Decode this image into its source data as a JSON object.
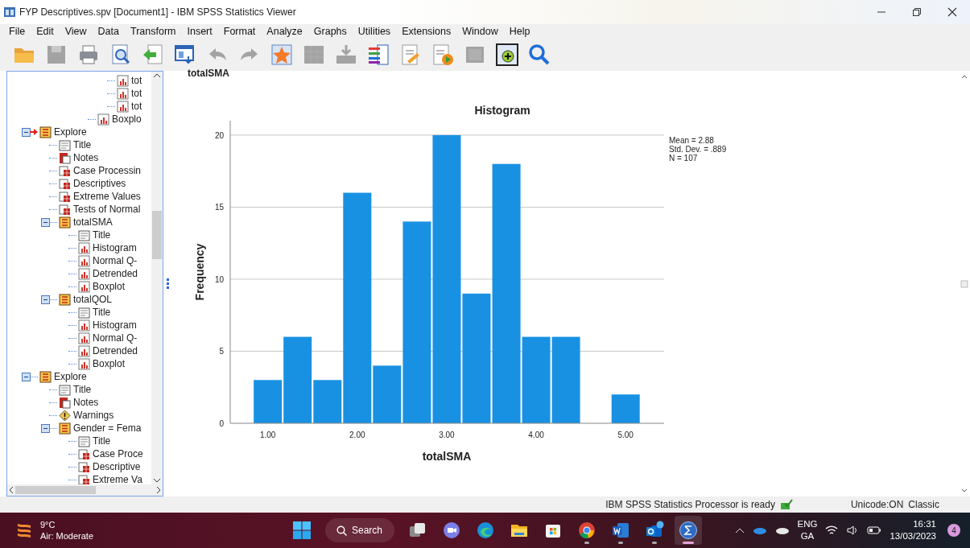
{
  "window": {
    "title": "FYP Descriptives.spv [Document1] - IBM SPSS Statistics Viewer"
  },
  "menu": [
    "File",
    "Edit",
    "View",
    "Data",
    "Transform",
    "Insert",
    "Format",
    "Analyze",
    "Graphs",
    "Utilities",
    "Extensions",
    "Window",
    "Help"
  ],
  "toolbar": [
    {
      "kind": "open",
      "disabled": false
    },
    {
      "kind": "save",
      "disabled": true
    },
    {
      "kind": "print",
      "disabled": false
    },
    {
      "kind": "preview",
      "disabled": false
    },
    {
      "kind": "export",
      "disabled": false
    },
    {
      "kind": "goto",
      "disabled": false
    },
    {
      "kind": "undo",
      "disabled": true
    },
    {
      "kind": "redo",
      "disabled": true
    },
    {
      "kind": "star",
      "disabled": false
    },
    {
      "kind": "grid",
      "disabled": true
    },
    {
      "kind": "insert",
      "disabled": true
    },
    {
      "kind": "variables",
      "disabled": false
    },
    {
      "kind": "note",
      "disabled": false
    },
    {
      "kind": "script",
      "disabled": false
    },
    {
      "kind": "square",
      "disabled": true
    },
    {
      "kind": "add",
      "disabled": false
    },
    {
      "kind": "search",
      "disabled": false
    }
  ],
  "tree": {
    "items": [
      {
        "children": [
          {
            "children": [
              {
                "children": [
                  {
                    "children": [
                      {
                        "label": "tot",
                        "kind": "chart"
                      },
                      {
                        "label": "tot",
                        "kind": "chart"
                      },
                      {
                        "label": "tot",
                        "kind": "chart"
                      }
                    ]
                  },
                  {
                    "label": "Boxplo",
                    "kind": "chart"
                  }
                ]
              }
            ]
          }
        ]
      },
      {
        "label": "Explore",
        "kind": "folder",
        "expanded": true,
        "current": true,
        "children": [
          {
            "label": "Title",
            "kind": "title"
          },
          {
            "label": "Notes",
            "kind": "notes"
          },
          {
            "label": "Case Processin",
            "kind": "table"
          },
          {
            "label": "Descriptives",
            "kind": "table"
          },
          {
            "label": "Extreme Values",
            "kind": "table"
          },
          {
            "label": "Tests of Normal",
            "kind": "table"
          },
          {
            "label": "totalSMA",
            "kind": "folder",
            "expanded": true,
            "current": false,
            "children": [
              {
                "label": "Title",
                "kind": "title"
              },
              {
                "label": "Histogram",
                "kind": "chart"
              },
              {
                "label": "Normal Q-",
                "kind": "chart"
              },
              {
                "label": "Detrended",
                "kind": "chart"
              },
              {
                "label": "Boxplot",
                "kind": "chart"
              }
            ]
          },
          {
            "label": "totalQOL",
            "kind": "folder",
            "expanded": true,
            "current": false,
            "children": [
              {
                "label": "Title",
                "kind": "title"
              },
              {
                "label": "Histogram",
                "kind": "chart"
              },
              {
                "label": "Normal Q-",
                "kind": "chart"
              },
              {
                "label": "Detrended",
                "kind": "chart"
              },
              {
                "label": "Boxplot",
                "kind": "chart"
              }
            ]
          }
        ]
      },
      {
        "label": "Explore",
        "kind": "folder",
        "expanded": true,
        "current": false,
        "children": [
          {
            "label": "Title",
            "kind": "title"
          },
          {
            "label": "Notes",
            "kind": "notes"
          },
          {
            "label": "Warnings",
            "kind": "warning"
          },
          {
            "label": "Gender  = Fema",
            "kind": "folder",
            "expanded": true,
            "current": false,
            "children": [
              {
                "label": "Title",
                "kind": "title"
              },
              {
                "label": "Case Proce",
                "kind": "table"
              },
              {
                "label": "Descriptive",
                "kind": "table"
              },
              {
                "label": "Extreme Va",
                "kind": "table"
              }
            ]
          }
        ]
      }
    ]
  },
  "output": {
    "heading": "totalSMA",
    "chart_data": {
      "type": "bar",
      "title": "Histogram",
      "xlabel": "totalSMA",
      "ylabel": "Frequency",
      "x": [
        1.0,
        1.333,
        1.667,
        2.0,
        2.333,
        2.667,
        3.0,
        3.333,
        3.667,
        4.0,
        4.333,
        4.667,
        5.0
      ],
      "values": [
        3,
        6,
        3,
        16,
        4,
        14,
        20,
        9,
        18,
        6,
        6,
        0,
        2
      ],
      "xlim": [
        0.58,
        5.43
      ],
      "ylim": [
        0,
        21
      ],
      "xticks": [
        {
          "value": 1,
          "label": "1.00"
        },
        {
          "value": 2,
          "label": "2.00"
        },
        {
          "value": 3,
          "label": "3.00"
        },
        {
          "value": 4,
          "label": "4.00"
        },
        {
          "value": 5,
          "label": "5.00"
        }
      ],
      "yticks": [
        0,
        5,
        10,
        15,
        20
      ],
      "grid": true,
      "annotations": [
        "Mean = 2.88",
        "Std. Dev. = .889",
        "N = 107"
      ]
    }
  },
  "status_bar": {
    "message": "IBM SPSS Statistics Processor is ready",
    "unicode": "Unicode:ON",
    "mode": "Classic"
  },
  "taskbar": {
    "weather": {
      "temp": "9°C",
      "text": "Air: Moderate"
    },
    "search": "Search",
    "apps": [
      {
        "kind": "start",
        "running": false,
        "active": false
      },
      {
        "kind": "search"
      },
      {
        "kind": "taskview",
        "running": false,
        "active": false
      },
      {
        "kind": "meet",
        "running": false,
        "active": false
      },
      {
        "kind": "edge",
        "running": false,
        "active": false
      },
      {
        "kind": "files",
        "running": false,
        "active": false
      },
      {
        "kind": "store",
        "running": false,
        "active": false
      },
      {
        "kind": "chrome",
        "running": true,
        "active": false
      },
      {
        "kind": "word",
        "running": true,
        "active": false
      },
      {
        "kind": "outlook",
        "running": true,
        "active": false
      },
      {
        "kind": "spss",
        "running": true,
        "active": true
      }
    ],
    "language": [
      "ENG",
      "GA"
    ],
    "time": "16:31",
    "date": "13/03/2023",
    "notifications": "4"
  }
}
